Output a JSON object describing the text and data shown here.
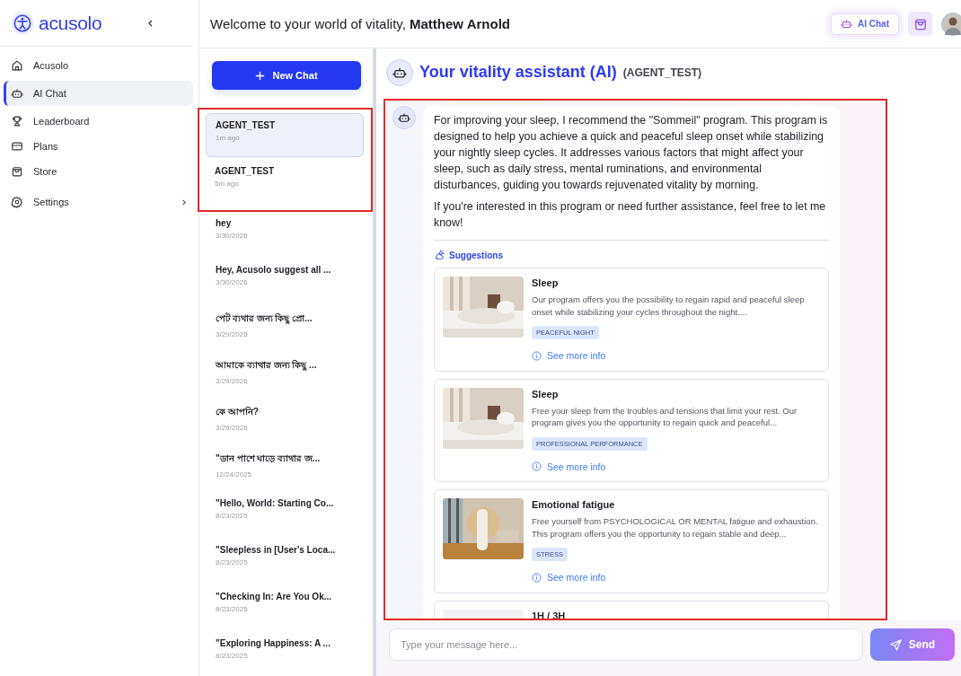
{
  "brand": {
    "name": "acusolo"
  },
  "nav": [
    {
      "label": "Acusolo",
      "selected": false,
      "has_submenu": false
    },
    {
      "label": "AI Chat",
      "selected": true,
      "has_submenu": false
    },
    {
      "label": "Leaderboard",
      "selected": false,
      "has_submenu": false
    },
    {
      "label": "Plans",
      "selected": false,
      "has_submenu": false
    },
    {
      "label": "Store",
      "selected": false,
      "has_submenu": false
    },
    {
      "label": "Settings",
      "selected": false,
      "has_submenu": true
    }
  ],
  "header": {
    "greeting": "Welcome to your world of vitality, **Matthew Arnold**",
    "ai_chat_button": "AI Chat"
  },
  "new_chat_button": "New Chat",
  "chats": [
    {
      "title": "AGENT_TEST",
      "time": "1m ago",
      "selected": true,
      "highlighted": true
    },
    {
      "title": "AGENT_TEST",
      "time": "5m ago",
      "selected": false,
      "highlighted": true
    },
    {
      "title": "hey",
      "time": "3/30/2026",
      "selected": false,
      "highlighted": false
    },
    {
      "title": "Hey, Acusolo suggest all ...",
      "time": "3/30/2026",
      "selected": false,
      "highlighted": false
    },
    {
      "title": "পেট ব্যথার জন্য কিছু প্রো...",
      "time": "3/29/2026",
      "selected": false,
      "highlighted": false
    },
    {
      "title": "আমাকে ব্যাথার জন্য কিছু ...",
      "time": "3/29/2026",
      "selected": false,
      "highlighted": false
    },
    {
      "title": "কে আপনি?",
      "time": "3/29/2026",
      "selected": false,
      "highlighted": false
    },
    {
      "title": "\"ডান পাশে ঘাড়ে ব্যাথার জ...",
      "time": "12/24/2025",
      "selected": false,
      "highlighted": false
    },
    {
      "title": "\"Hello, World: Starting Co...",
      "time": "8/23/2025",
      "selected": false,
      "highlighted": false
    },
    {
      "title": "\"Sleepless in [User's Loca...",
      "time": "8/23/2025",
      "selected": false,
      "highlighted": false
    },
    {
      "title": "\"Checking In: Are You Ok...",
      "time": "8/23/2025",
      "selected": false,
      "highlighted": false
    },
    {
      "title": "\"Exploring Happiness: A ...",
      "time": "8/23/2025",
      "selected": false,
      "highlighted": false
    }
  ],
  "assistant": {
    "title": "Your vitality assistant (AI)",
    "agent": "(AGENT_TEST)"
  },
  "conversation": {
    "highlighted": true,
    "messages": [
      {
        "paragraphs": [
          "For improving your sleep, I recommend the \"Sommeil\" program. This program is designed to help you achieve a quick and peaceful sleep onset while stabilizing your nightly sleep cycles. It addresses various factors that might affect your sleep, such as daily stress, mental ruminations, and environmental disturbances, guiding you towards rejuvenated vitality by morning.",
          "If you're interested in this program or need further assistance, feel free to let me know!"
        ],
        "suggestions_label": "Suggestions",
        "suggestions": [
          {
            "title": "Sleep",
            "description": "Our program offers you the possibility to regain rapid and peaceful sleep onset while stabilizing your cycles throughout the night....",
            "tag": "PEACEFUL NIGHT",
            "link": "See more info"
          },
          {
            "title": "Sleep",
            "description": "Free your sleep from the troubles and tensions that limit your rest. Our program gives you the opportunity to regain quick and peaceful...",
            "tag": "PROFESSIONAL PERFORMANCE",
            "link": "See more info"
          },
          {
            "title": "Emotional fatigue",
            "description": "Free yourself from PSYCHOLOGICAL OR MENTAL fatigue and exhaustion. This program offers you the opportunity to regain stable and deep...",
            "tag": "STRESS",
            "link": "See more info"
          },
          {
            "title": "1H / 3H"
          }
        ]
      }
    ]
  },
  "composer": {
    "placeholder": "Type your message here...",
    "send": "Send"
  }
}
